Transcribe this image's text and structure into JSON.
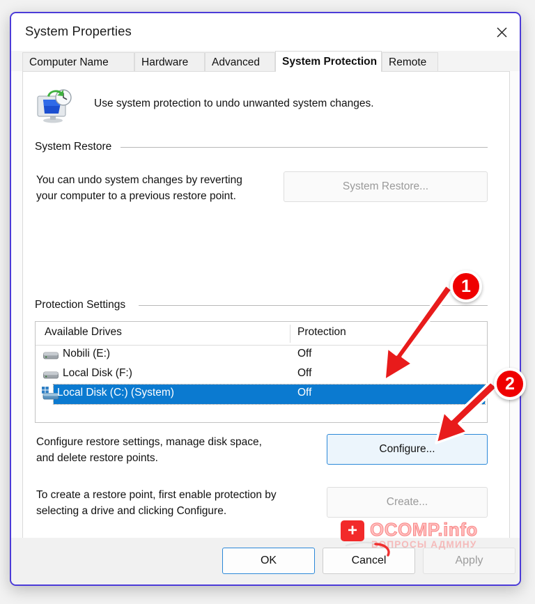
{
  "window": {
    "title": "System Properties",
    "close_label": "close-icon"
  },
  "tabs": [
    {
      "label": "Computer Name",
      "active": false
    },
    {
      "label": "Hardware",
      "active": false
    },
    {
      "label": "Advanced",
      "active": false
    },
    {
      "label": "System Protection",
      "active": true
    },
    {
      "label": "Remote",
      "active": false
    }
  ],
  "hero": {
    "text": "Use system protection to undo unwanted system changes.",
    "icon": "system-restore-monitor-icon"
  },
  "system_restore": {
    "group_label": "System Restore",
    "description": "You can undo system changes by reverting\nyour computer to a previous restore point.",
    "button_label": "System Restore...",
    "button_disabled": true
  },
  "protection_settings": {
    "group_label": "Protection Settings",
    "columns": [
      "Available Drives",
      "Protection"
    ],
    "rows": [
      {
        "name": "Nobili (E:)",
        "protection": "Off",
        "selected": false,
        "icon": "hard-drive-icon"
      },
      {
        "name": "Local Disk (F:)",
        "protection": "Off",
        "selected": false,
        "icon": "hard-drive-icon"
      },
      {
        "name": "Local Disk (C:) (System)",
        "protection": "Off",
        "selected": true,
        "icon": "system-drive-icon"
      }
    ],
    "configure": {
      "description": "Configure restore settings, manage disk space,\nand delete restore points.",
      "button_label": "Configure...",
      "button_disabled": false,
      "button_focused": true
    },
    "create": {
      "description": "To create a restore point, first enable protection by\nselecting a drive and clicking Configure.",
      "button_label": "Create...",
      "button_disabled": true
    }
  },
  "command_bar": {
    "ok_label": "OK",
    "cancel_label": "Cancel",
    "apply_label": "Apply",
    "apply_disabled": true,
    "ok_default": true
  },
  "watermark": {
    "title": "OCOMP.info",
    "subtitle": "ВОПРОСЫ АДМИНУ",
    "icon": "red-cross-icon"
  },
  "annotations": [
    {
      "number": "1",
      "target": "selected-drive-row"
    },
    {
      "number": "2",
      "target": "configure-button"
    }
  ],
  "colors": {
    "selection_blue": "#0b7ad0",
    "annotation_red": "#ef0000",
    "focus_blue": "#2b88d8",
    "window_border": "#4b3bd8"
  }
}
